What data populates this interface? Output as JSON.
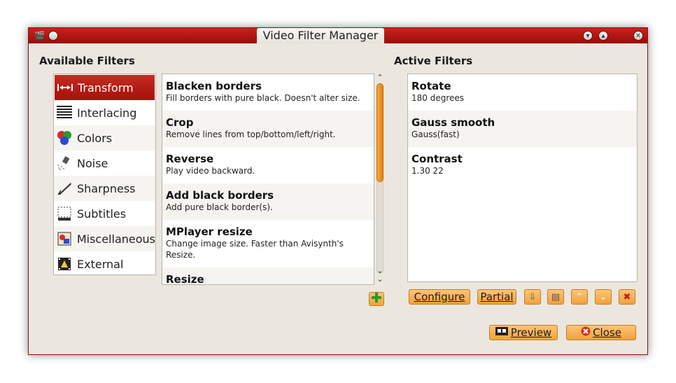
{
  "window": {
    "title": "Video Filter Manager"
  },
  "available": {
    "label": "Available Filters",
    "categories": [
      {
        "label": "Transform",
        "icon": "transform-icon"
      },
      {
        "label": "Interlacing",
        "icon": "interlacing-icon"
      },
      {
        "label": "Colors",
        "icon": "colors-icon"
      },
      {
        "label": "Noise",
        "icon": "noise-icon"
      },
      {
        "label": "Sharpness",
        "icon": "sharpness-icon"
      },
      {
        "label": "Subtitles",
        "icon": "subtitles-icon"
      },
      {
        "label": "Miscellaneous",
        "icon": "miscellaneous-icon"
      },
      {
        "label": "External",
        "icon": "external-icon"
      }
    ],
    "selected_category": "Transform",
    "filters": [
      {
        "name": "Blacken borders",
        "desc": "Fill borders with pure black. Doesn't alter size."
      },
      {
        "name": "Crop",
        "desc": "Remove lines from top/bottom/left/right."
      },
      {
        "name": "Reverse",
        "desc": "Play video backward."
      },
      {
        "name": "Add black borders",
        "desc": "Add pure black border(s)."
      },
      {
        "name": "MPlayer resize",
        "desc": "Change image size. Faster than Avisynth's Resize."
      },
      {
        "name": "Resize",
        "desc": ""
      }
    ],
    "scroll": {
      "thumb_fraction": 0.52
    },
    "add_button_icon": "add-icon"
  },
  "active": {
    "label": "Active Filters",
    "filters": [
      {
        "name": "Rotate",
        "desc": "180 degrees"
      },
      {
        "name": "Gauss smooth",
        "desc": "Gauss(fast)"
      },
      {
        "name": "Contrast",
        "desc": "1.30 22"
      }
    ]
  },
  "buttons": {
    "configure": "Configure",
    "partial": "Partial",
    "preview": "Preview",
    "close": "Close"
  },
  "colors": {
    "accent_red": "#b01610",
    "button_orange": "#f5a84a",
    "scroll_orange": "#ee8f20"
  }
}
